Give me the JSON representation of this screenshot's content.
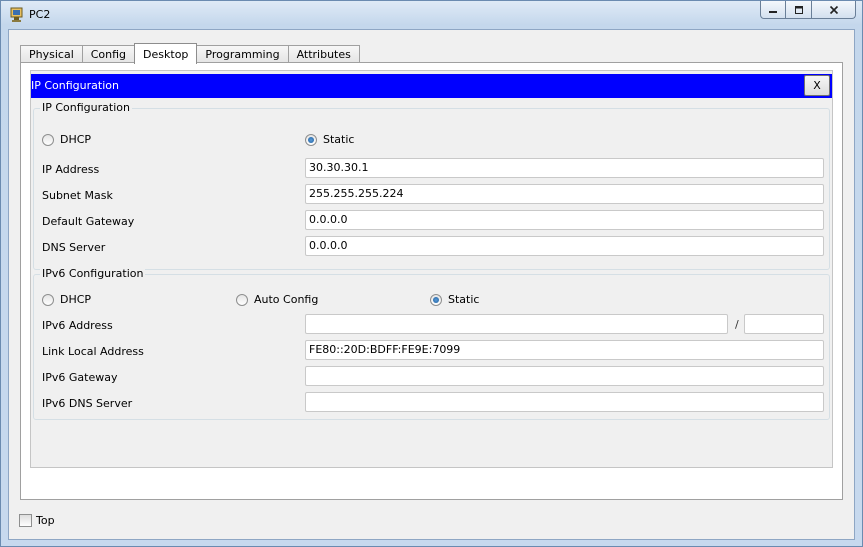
{
  "window": {
    "title": "PC2",
    "buttons": {
      "minimize": "minimize",
      "maximize": "maximize",
      "close": "close"
    }
  },
  "tabs": [
    {
      "label": "Physical",
      "active": false
    },
    {
      "label": "Config",
      "active": false
    },
    {
      "label": "Desktop",
      "active": true
    },
    {
      "label": "Programming",
      "active": false
    },
    {
      "label": "Attributes",
      "active": false
    }
  ],
  "ip_config_panel": {
    "header": "IP Configuration",
    "close_label": "X",
    "ipv4": {
      "legend": "IP Configuration",
      "dhcp_label": "DHCP",
      "static_label": "Static",
      "mode": "static",
      "ip_address_label": "IP Address",
      "ip_address": "30.30.30.1",
      "subnet_mask_label": "Subnet Mask",
      "subnet_mask": "255.255.255.224",
      "default_gateway_label": "Default Gateway",
      "default_gateway": "0.0.0.0",
      "dns_server_label": "DNS Server",
      "dns_server": "0.0.0.0"
    },
    "ipv6": {
      "legend": "IPv6 Configuration",
      "dhcp_label": "DHCP",
      "auto_config_label": "Auto Config",
      "static_label": "Static",
      "mode": "static",
      "ipv6_address_label": "IPv6 Address",
      "ipv6_address": "",
      "prefix_separator": "/",
      "prefix_length": "",
      "link_local_label": "Link Local Address",
      "link_local": "FE80::20D:BDFF:FE9E:7099",
      "ipv6_gateway_label": "IPv6 Gateway",
      "ipv6_gateway": "",
      "ipv6_dns_label": "IPv6 DNS Server",
      "ipv6_dns": ""
    }
  },
  "bottom": {
    "top_label": "Top",
    "top_checked": false
  },
  "colors": {
    "header_bg": "#0000ff",
    "header_text": "#ffffff",
    "radio_accent": "#1d5fa0"
  }
}
